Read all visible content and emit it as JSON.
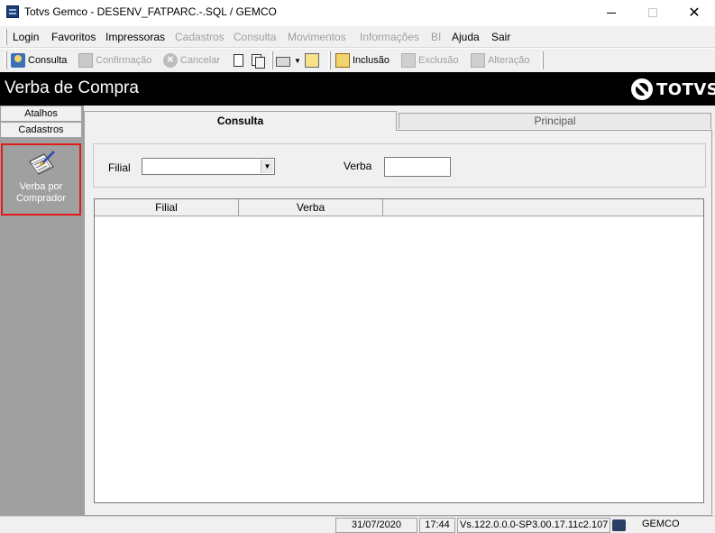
{
  "window": {
    "title": "Totvs Gemco - DESENV_FATPARC.-.SQL / GEMCO",
    "min": "—",
    "max": "☐",
    "close": "✕"
  },
  "menu": [
    {
      "label": "Login",
      "enabled": true
    },
    {
      "label": "Favoritos",
      "enabled": true
    },
    {
      "label": "Impressoras",
      "enabled": true
    },
    {
      "label": "Cadastros",
      "enabled": false
    },
    {
      "label": "Consulta",
      "enabled": false
    },
    {
      "label": "Movimentos",
      "enabled": false
    },
    {
      "label": "Informações",
      "enabled": false
    },
    {
      "label": "BI",
      "enabled": false
    },
    {
      "label": "Ajuda",
      "enabled": true
    },
    {
      "label": "Sair",
      "enabled": true
    }
  ],
  "toolbar": {
    "consulta": "Consulta",
    "confirmacao": "Confirmação",
    "cancelar": "Cancelar",
    "inclusao": "Inclusão",
    "exclusao": "Exclusão",
    "alteracao": "Alteração"
  },
  "header": {
    "title": "Verba de Compra",
    "logo_text": "TOTVS"
  },
  "sidebar": {
    "tabs": [
      "Atalhos",
      "Cadastros"
    ],
    "shortcut_label": "Verba por Comprador"
  },
  "tabs": {
    "consulta": "Consulta",
    "principal": "Principal"
  },
  "filter": {
    "filial_label": "Filial",
    "filial_value": "",
    "verba_label": "Verba",
    "verba_value": ""
  },
  "grid": {
    "columns": [
      "Filial",
      "Verba",
      ""
    ],
    "rows": []
  },
  "status": {
    "date": "31/07/2020",
    "time": "17:44",
    "version": "Vs.122.0.0.0-SP3.00.17.11c2.107",
    "user": "GEMCO"
  },
  "colors": {
    "header_bg": "#000000",
    "sidebar_bg": "#a0a0a0",
    "highlight_border": "#e01b1b",
    "chrome_bg": "#f0f0f0"
  }
}
